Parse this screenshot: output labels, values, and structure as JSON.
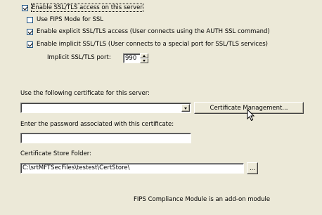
{
  "options": {
    "enable_ssl": {
      "label": "Enable SSL/TLS access on this server",
      "checked": true
    },
    "fips_mode": {
      "label": "Use FIPS Mode for SSL",
      "checked": false
    },
    "explicit_ssl": {
      "label": "Enable explicit SSL/TLS access (User connects using the AUTH SSL command)",
      "checked": true
    },
    "implicit_ssl": {
      "label": "Enable implicit SSL/TLS (User connects to a special port for SSL/TLS services)",
      "checked": true
    }
  },
  "implicit_port": {
    "label": "Implicit SSL/TLS port:",
    "value": "990"
  },
  "certificate": {
    "label": "Use the following certificate for this server:",
    "selected": "",
    "management_button": "Certificate Management..."
  },
  "password": {
    "label": "Enter the password associated with this certificate:",
    "value": ""
  },
  "cert_store": {
    "label": "Certificate Store Folder:",
    "value": "C:\\srtMFTSecFiles\\testest\\CertStore\\",
    "browse_button": "..."
  },
  "footer": {
    "note": "FIPS Compliance Module is an add-on module"
  },
  "colors": {
    "background": "#ece9d8",
    "field": "#ffffff",
    "checkbox_border": "#1c5180"
  }
}
